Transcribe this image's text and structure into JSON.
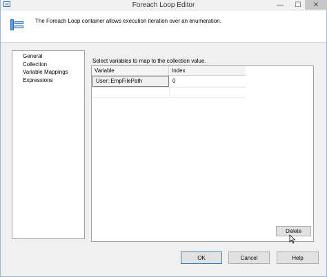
{
  "window": {
    "title": "Foreach Loop Editor",
    "controls": {
      "minimize": "—",
      "maximize": "☐",
      "close": "✕"
    }
  },
  "header": {
    "description": "The Foreach Loop container allows execution iteration over an enumeration.",
    "icon": "foreach-container-icon"
  },
  "nav": {
    "items": [
      {
        "label": "General"
      },
      {
        "label": "Collection"
      },
      {
        "label": "Variable Mappings"
      },
      {
        "label": "Expressions"
      }
    ]
  },
  "main": {
    "instructions": "Select variables to map to the collection value.",
    "columns": [
      "Variable",
      "Index"
    ],
    "rows": [
      {
        "variable": "User::EmpFilePath",
        "index": "0"
      }
    ]
  },
  "buttons": {
    "delete": "Delete",
    "ok": "OK",
    "cancel": "Cancel",
    "help": "Help"
  },
  "colors": {
    "accent": "#3c7fb1",
    "window_bg": "#f0f0f0"
  }
}
